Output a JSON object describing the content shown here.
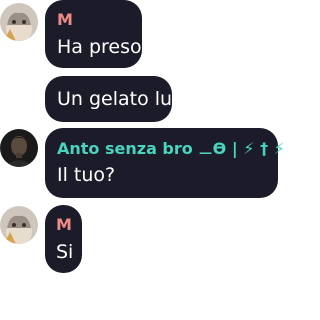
{
  "colors": {
    "bubble": "#1c1b29",
    "sender_m": "#f08a87",
    "sender_anto": "#48d4bd",
    "message_text": "#ffffff"
  },
  "messages": [
    {
      "sender": "M",
      "avatar": "avatar-cat-photo",
      "texts": [
        "Ha preso",
        "Un gelato lui"
      ]
    },
    {
      "sender": "Anto senza bro ⚊ϴ | ⚡ † ⚡",
      "avatar": "avatar-person-dark-photo",
      "texts": [
        "Il tuo?"
      ]
    },
    {
      "sender": "M",
      "avatar": "avatar-cat-photo",
      "texts": [
        "Si"
      ]
    }
  ]
}
